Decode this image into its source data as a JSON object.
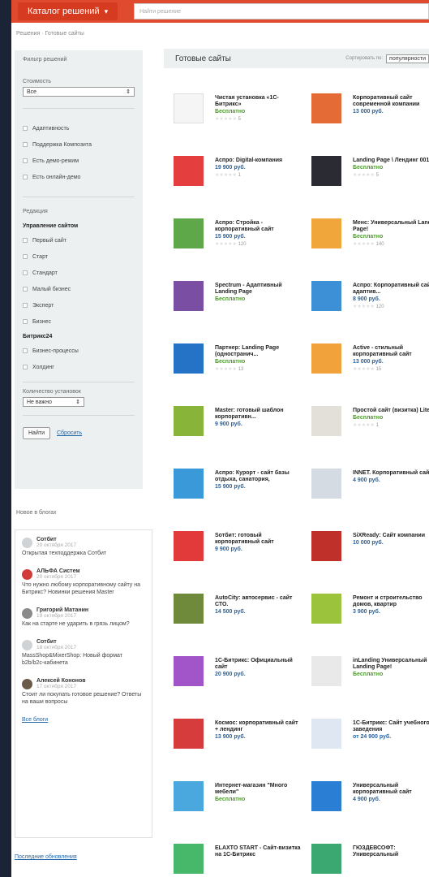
{
  "header": {
    "catalog_label": "Каталог решений",
    "search_placeholder": "Найти решение"
  },
  "breadcrumb": "Решения · Готовые сайты",
  "filter": {
    "title": "Фильтр решений",
    "price_label": "Стоимость",
    "price_value": "Все",
    "options_a": [
      "Адаптивность",
      "Поддержка Композита",
      "Есть демо-режим",
      "Есть онлайн-демо"
    ],
    "edition_label": "Редакция",
    "group1": "Управление сайтом",
    "options_b": [
      "Первый сайт",
      "Старт",
      "Стандарт",
      "Малый бизнес",
      "Эксперт",
      "Бизнес"
    ],
    "group2": "Битрикс24",
    "options_c": [
      "Бизнес-процессы",
      "Холдинг"
    ],
    "installs_label": "Количество установок",
    "installs_value": "Не важно",
    "find_label": "Найти",
    "reset_label": "Сбросить"
  },
  "blog": {
    "heading": "Новое в блогах",
    "items": [
      {
        "name": "Сотбит",
        "date": "20 октября 2017",
        "text": "Открытая техподдержка Сотбит"
      },
      {
        "name": "АЛЬФА Систем",
        "date": "20 октября 2017",
        "text": "Что нужно любому корпоративному сайту на Битрикс? Новинки решения Master"
      },
      {
        "name": "Григорий Матанин",
        "date": "19 октября 2017",
        "text": "Как на старте не ударить в грязь лицом?"
      },
      {
        "name": "Сотбит",
        "date": "18 октября 2017",
        "text": "MassShop&MixerShop: Новый формат b2b/b2c-кабинета"
      },
      {
        "name": "Алексей Кононов",
        "date": "17 октября 2017",
        "text": "Стоит ли покупать готовое решение? Ответы на ваши вопросы"
      }
    ],
    "all_label": "Все блоги",
    "last_updates": "Последние обновления"
  },
  "main": {
    "title": "Готовые сайты",
    "sort_label": "Сортировать по:",
    "sort_value": "популярности"
  },
  "cards": [
    {
      "title": "Чистая установка «1С-Битрикс»",
      "price": "Бесплатно",
      "installs": "5",
      "color": "#f5f5f5"
    },
    {
      "title": "Корпоративный сайт современной компании",
      "price": "13 000 руб.",
      "installs": "",
      "color": "#e46b35"
    },
    {
      "title": "Аспро: Digital-компания",
      "price": "19 900 руб.",
      "installs": "1",
      "color": "#e53e3e"
    },
    {
      "title": "Landing Page \\ Лендинг 001",
      "price": "Бесплатно",
      "installs": "5",
      "color": "#2b2b33"
    },
    {
      "title": "Аспро: Стройка - корпоративный сайт",
      "price": "15 900 руб.",
      "installs": "120",
      "color": "#5ea84a"
    },
    {
      "title": "Менс: Универсальный Landing Page!",
      "price": "Бесплатно",
      "installs": "140",
      "color": "#f0a63a"
    },
    {
      "title": "Spectrum - Адаптивный Landing Page",
      "price": "Бесплатно",
      "installs": "",
      "color": "#7a4ea3"
    },
    {
      "title": "Аспро: Корпоративный сайт, адаптив...",
      "price": "8 900 руб.",
      "installs": "120",
      "color": "#3d8fd6"
    },
    {
      "title": "Партнер: Landing Page (одностранич...",
      "price": "Бесплатно",
      "installs": "13",
      "color": "#2473c7"
    },
    {
      "title": "Active - стильный корпоративный сайт",
      "price": "13 000 руб.",
      "installs": "15",
      "color": "#f2a23b"
    },
    {
      "title": "Master: готовый шаблон корпоративн...",
      "price": "9 900 руб.",
      "installs": "",
      "color": "#88b43a"
    },
    {
      "title": "Простой сайт (визитка) Lite",
      "price": "Бесплатно",
      "installs": "1",
      "color": "#e3e0da"
    },
    {
      "title": "Аспро: Курорт - сайт базы отдыха, санатория,",
      "price": "15 900 руб.",
      "installs": "",
      "color": "#3a9ad9"
    },
    {
      "title": "INNET. Корпоративный сайт v8",
      "price": "4 900 руб.",
      "installs": "",
      "color": "#d4dbe3"
    },
    {
      "title": "Sотбит: готовый корпоративный сайт",
      "price": "9 900 руб.",
      "installs": "",
      "color": "#e23a3a"
    },
    {
      "title": "SiXReady: Сайт компании",
      "price": "10 000 руб.",
      "installs": "",
      "color": "#c0302b"
    },
    {
      "title": "AutoCity: автосервис - сайт СТО.",
      "price": "14 500 руб.",
      "installs": "",
      "color": "#6f8a3a"
    },
    {
      "title": "Ремонт и строительство домов, квартир",
      "price": "3 900 руб.",
      "installs": "",
      "color": "#9bc33c"
    },
    {
      "title": "1С-Битрикс: Официальный сайт",
      "price": "20 900 руб.",
      "installs": "",
      "color": "#a255c8"
    },
    {
      "title": "inLanding Универсальный Landing Page!",
      "price": "Бесплатно",
      "installs": "",
      "color": "#e9e9e9"
    },
    {
      "title": "Космос: корпоративный сайт + лендинг",
      "price": "13 900 руб.",
      "installs": "",
      "color": "#d73c3c"
    },
    {
      "title": "1С-Битрикс: Сайт учебного заведения",
      "price": "от 24 900 руб.",
      "installs": "",
      "color": "#dfe8f2"
    },
    {
      "title": "Интернет-магазин \"Много мебели\"",
      "price": "Бесплатно",
      "installs": "",
      "color": "#4aa8de"
    },
    {
      "title": "Универсальный корпоративный сайт",
      "price": "4 900 руб.",
      "installs": "",
      "color": "#2a7fd4"
    },
    {
      "title": "ELAXTO START - Сайт-визитка на 1С-Битрикс",
      "price": "",
      "installs": "",
      "color": "#47b86a"
    },
    {
      "title": "ГЮЗДЕВСОФТ: Универсальный",
      "price": "",
      "installs": "",
      "color": "#3aa870"
    }
  ]
}
